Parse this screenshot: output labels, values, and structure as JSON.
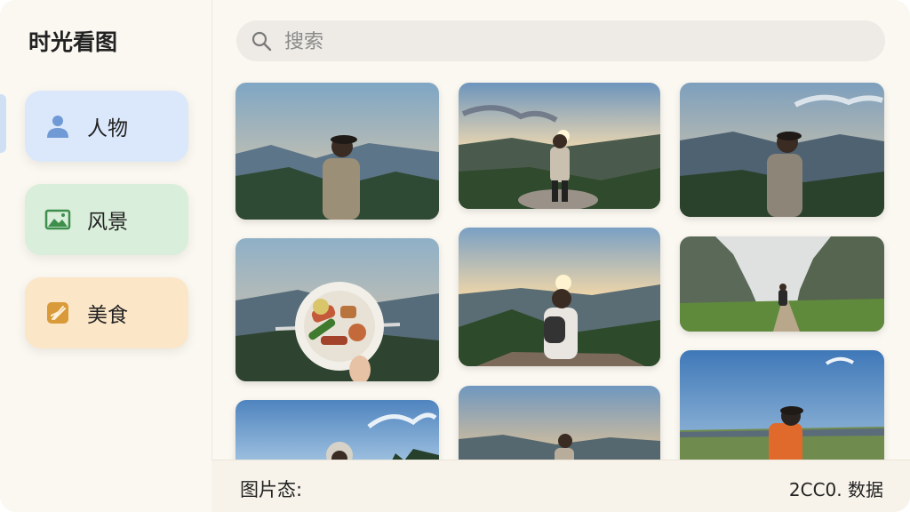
{
  "app": {
    "title": "时光看图"
  },
  "sidebar": {
    "items": [
      {
        "label": "人物",
        "icon": "person-icon",
        "color": "#dbe8fb"
      },
      {
        "label": "风景",
        "icon": "landscape-icon",
        "color": "#d9eedb"
      },
      {
        "label": "美食",
        "icon": "food-icon",
        "color": "#fbe6c8"
      }
    ]
  },
  "search": {
    "placeholder": "搜索",
    "value": ""
  },
  "grid": {
    "photos": [
      {
        "subject": "woman-hat-mountains"
      },
      {
        "subject": "woman-sunset-hill"
      },
      {
        "subject": "woman-hat-valley"
      },
      {
        "subject": "food-plate-mountains"
      },
      {
        "subject": "woman-backpack-sunset"
      },
      {
        "subject": "person-canyon-valley"
      },
      {
        "subject": "person-sky-partial"
      },
      {
        "subject": "woman-mountains-partial"
      },
      {
        "subject": "woman-field-partial"
      }
    ]
  },
  "status": {
    "label": "图片态:",
    "count": "2CC0. 数据"
  },
  "colors": {
    "accent_people": "#dbe8fb",
    "accent_scenery": "#d9eedb",
    "accent_food": "#fbe6c8",
    "background": "#fbf8f1"
  }
}
